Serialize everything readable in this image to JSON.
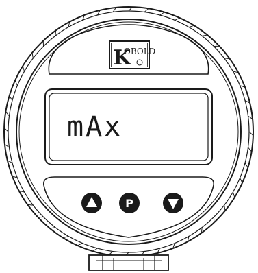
{
  "brand": {
    "initial": "K",
    "rest": "OBOLD"
  },
  "display": {
    "text": "mAx"
  },
  "buttons": {
    "up_label": "▲",
    "program_label": "P",
    "down_label": "▼"
  }
}
